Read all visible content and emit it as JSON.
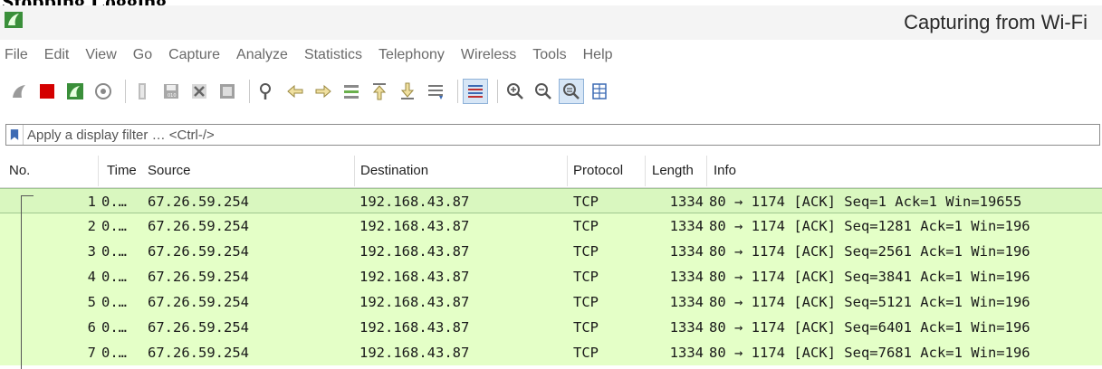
{
  "doc": {
    "heading": "Stopping Logging"
  },
  "window": {
    "title": "Capturing from Wi-Fi",
    "logo_icon": "shark-fin-icon",
    "accent": "#4caf50"
  },
  "menu": [
    "File",
    "Edit",
    "View",
    "Go",
    "Capture",
    "Analyze",
    "Statistics",
    "Telephony",
    "Wireless",
    "Tools",
    "Help"
  ],
  "toolbar": {
    "icons": [
      "start-capture-icon",
      "stop-capture-icon",
      "restart-capture-icon",
      "capture-options-icon",
      "open-file-icon",
      "save-file-icon",
      "close-file-icon",
      "reload-file-icon",
      "find-packet-icon",
      "go-back-icon",
      "go-forward-icon",
      "go-to-packet-icon",
      "go-first-icon",
      "go-last-icon",
      "auto-scroll-icon",
      "colorize-icon",
      "zoom-in-icon",
      "zoom-out-icon",
      "normal-size-icon",
      "resize-columns-icon"
    ]
  },
  "filter": {
    "placeholder": "Apply a display filter … <Ctrl-/>",
    "value": ""
  },
  "columns": {
    "no": "No.",
    "time": "Time",
    "source": "Source",
    "destination": "Destination",
    "protocol": "Protocol",
    "length": "Length",
    "info": "Info"
  },
  "packets": [
    {
      "no": "1",
      "time": "0.…",
      "source": "67.26.59.254",
      "destination": "192.168.43.87",
      "protocol": "TCP",
      "length": "1334",
      "info": "80 → 1174 [ACK] Seq=1 Ack=1 Win=19655"
    },
    {
      "no": "2",
      "time": "0.…",
      "source": "67.26.59.254",
      "destination": "192.168.43.87",
      "protocol": "TCP",
      "length": "1334",
      "info": "80 → 1174 [ACK] Seq=1281 Ack=1 Win=196"
    },
    {
      "no": "3",
      "time": "0.…",
      "source": "67.26.59.254",
      "destination": "192.168.43.87",
      "protocol": "TCP",
      "length": "1334",
      "info": "80 → 1174 [ACK] Seq=2561 Ack=1 Win=196"
    },
    {
      "no": "4",
      "time": "0.…",
      "source": "67.26.59.254",
      "destination": "192.168.43.87",
      "protocol": "TCP",
      "length": "1334",
      "info": "80 → 1174 [ACK] Seq=3841 Ack=1 Win=196"
    },
    {
      "no": "5",
      "time": "0.…",
      "source": "67.26.59.254",
      "destination": "192.168.43.87",
      "protocol": "TCP",
      "length": "1334",
      "info": "80 → 1174 [ACK] Seq=5121 Ack=1 Win=196"
    },
    {
      "no": "6",
      "time": "0.…",
      "source": "67.26.59.254",
      "destination": "192.168.43.87",
      "protocol": "TCP",
      "length": "1334",
      "info": "80 → 1174 [ACK] Seq=6401 Ack=1 Win=196"
    },
    {
      "no": "7",
      "time": "0.…",
      "source": "67.26.59.254",
      "destination": "192.168.43.87",
      "protocol": "TCP",
      "length": "1334",
      "info": "80 → 1174 [ACK] Seq=7681 Ack=1 Win=196"
    }
  ],
  "colors": {
    "row_bg": "#e4ffc7",
    "stop_red": "#d40000"
  }
}
